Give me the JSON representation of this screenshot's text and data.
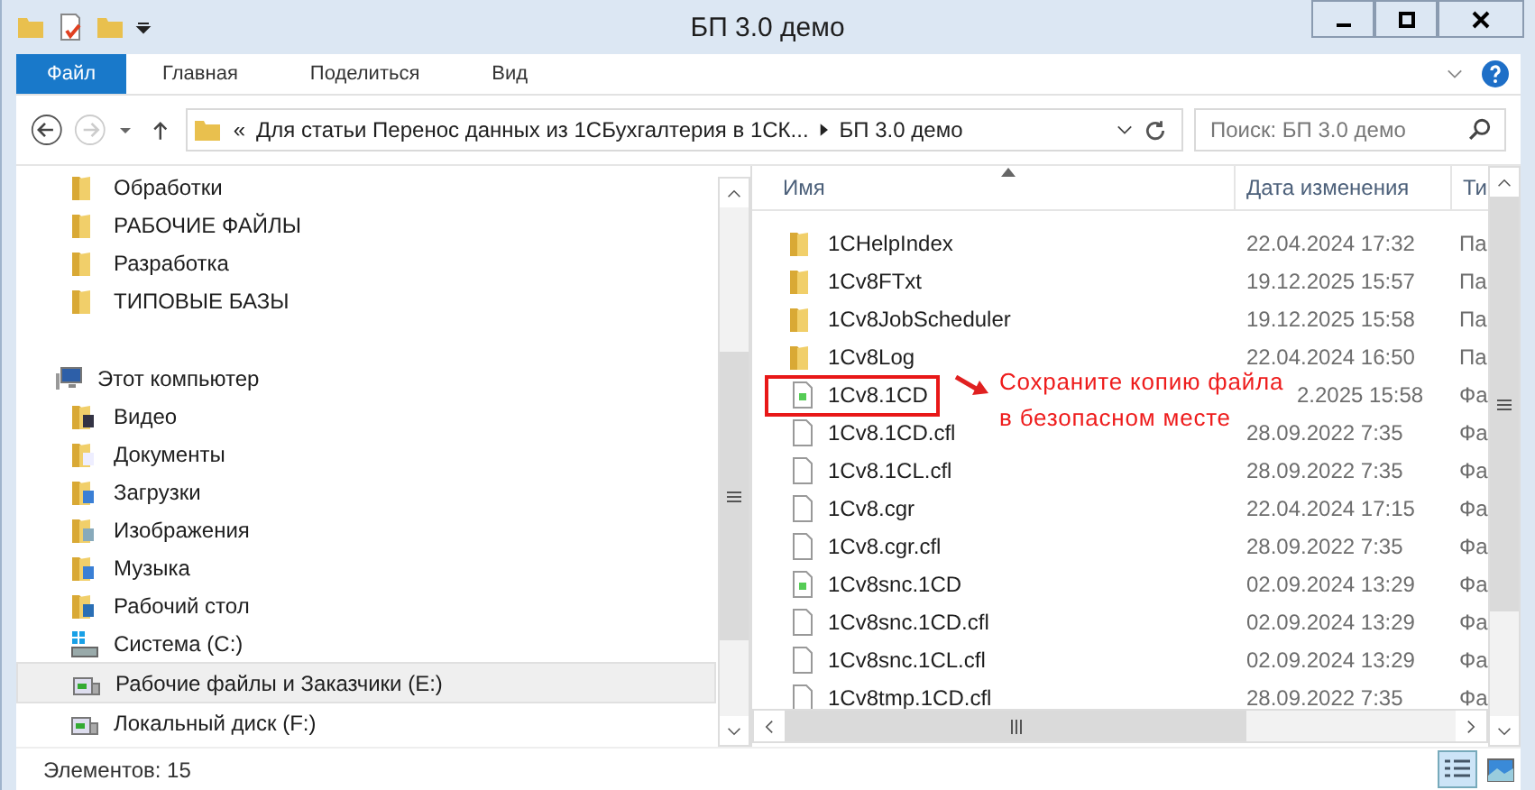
{
  "window": {
    "title": "БП 3.0 демо"
  },
  "ribbon_tabs": [
    {
      "label": "Файл",
      "selected": true
    },
    {
      "label": "Главная",
      "selected": false
    },
    {
      "label": "Поделиться",
      "selected": false
    },
    {
      "label": "Вид",
      "selected": false
    }
  ],
  "address": {
    "prefix": "«",
    "segments": [
      "Для статьи Перенос данных из 1СБухгалтерия в 1СК...",
      "БП 3.0 демо"
    ]
  },
  "search": {
    "placeholder": "Поиск: БП 3.0 демо"
  },
  "nav": {
    "items": [
      {
        "label": "Обработки",
        "kind": "folder",
        "selected": false
      },
      {
        "label": "РАБОЧИЕ ФАЙЛЫ",
        "kind": "folder",
        "selected": false
      },
      {
        "label": "Разработка",
        "kind": "folder",
        "selected": false
      },
      {
        "label": "ТИПОВЫЕ БАЗЫ",
        "kind": "folder",
        "selected": false
      }
    ],
    "computer": {
      "label": "Этот компьютер",
      "children": [
        {
          "label": "Видео",
          "kind": "video",
          "selected": false
        },
        {
          "label": "Документы",
          "kind": "documents",
          "selected": false
        },
        {
          "label": "Загрузки",
          "kind": "downloads",
          "selected": false
        },
        {
          "label": "Изображения",
          "kind": "images",
          "selected": false
        },
        {
          "label": "Музыка",
          "kind": "music",
          "selected": false
        },
        {
          "label": "Рабочий стол",
          "kind": "desktop",
          "selected": false
        },
        {
          "label": "Система (C:)",
          "kind": "system",
          "selected": false
        },
        {
          "label": "Рабочие файлы и Заказчики (E:)",
          "kind": "drive",
          "selected": true
        },
        {
          "label": "Локальный диск (F:)",
          "kind": "drive",
          "selected": false
        }
      ]
    }
  },
  "files": {
    "columns": [
      "Имя",
      "Дата изменения",
      "Ти"
    ],
    "rows": [
      {
        "name": "1CHelpIndex",
        "date": "22.04.2024 17:32",
        "column_3": "Па",
        "kind": "folder"
      },
      {
        "name": "1Cv8FTxt",
        "date": "19.12.2025 15:57",
        "column_3": "Па",
        "kind": "folder"
      },
      {
        "name": "1Cv8JobScheduler",
        "date": "19.12.2025 15:58",
        "column_3": "Па",
        "kind": "folder"
      },
      {
        "name": "1Cv8Log",
        "date": "22.04.2024 16:50",
        "column_3": "Па",
        "kind": "folder"
      },
      {
        "name": "1Cv8.1CD",
        "date": "2.2025 15:58",
        "column_3": "Фа",
        "kind": "db",
        "highlighted": true
      },
      {
        "name": "1Cv8.1CD.cfl",
        "date": "28.09.2022 7:35",
        "column_3": "Фа",
        "kind": "file"
      },
      {
        "name": "1Cv8.1CL.cfl",
        "date": "28.09.2022 7:35",
        "column_3": "Фа",
        "kind": "file"
      },
      {
        "name": "1Cv8.cgr",
        "date": "22.04.2024 17:15",
        "column_3": "Фа",
        "kind": "file"
      },
      {
        "name": "1Cv8.cgr.cfl",
        "date": "28.09.2022 7:35",
        "column_3": "Фа",
        "kind": "file"
      },
      {
        "name": "1Cv8snc.1CD",
        "date": "02.09.2024 13:29",
        "column_3": "Фа",
        "kind": "db"
      },
      {
        "name": "1Cv8snc.1CD.cfl",
        "date": "02.09.2024 13:29",
        "column_3": "Фа",
        "kind": "file"
      },
      {
        "name": "1Cv8snc.1CL.cfl",
        "date": "02.09.2024 13:29",
        "column_3": "Фа",
        "kind": "file"
      },
      {
        "name": "1Cv8tmp.1CD.cfl",
        "date": "28.09.2022 7:35",
        "column_3": "Фа",
        "kind": "file"
      }
    ]
  },
  "annotation": {
    "lines": [
      "Сохраните копию файла",
      "в безопасном месте"
    ]
  },
  "status_bar": {
    "text": "Элементов: 15"
  },
  "view_buttons": [
    {
      "kind": "details",
      "selected": true
    },
    {
      "kind": "thumbnails",
      "selected": false
    }
  ]
}
